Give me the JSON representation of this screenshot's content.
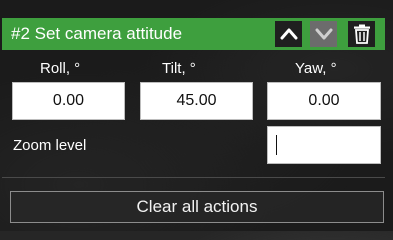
{
  "action": {
    "title": "#2 Set camera attitude",
    "up_icon": "chevron-up-icon",
    "down_icon": "chevron-down-icon",
    "delete_icon": "trash-icon"
  },
  "attitude": {
    "roll_label": "Roll, °",
    "roll_value": "0.00",
    "tilt_label": "Tilt, °",
    "tilt_value": "45.00",
    "yaw_label": "Yaw, °",
    "yaw_value": "0.00"
  },
  "zoom": {
    "label": "Zoom level",
    "value": ""
  },
  "footer": {
    "clear_label": "Clear all actions"
  },
  "colors": {
    "header_bg": "#3e9f3e",
    "button_dark": "#1f1f1f",
    "button_disabled": "#6c6c6c"
  }
}
